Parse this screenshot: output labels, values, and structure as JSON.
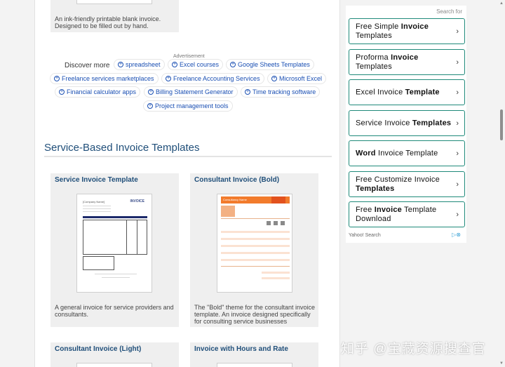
{
  "top_card": {
    "description": "An ink-friendly printable blank invoice. Designed to be filled out by hand."
  },
  "ad": {
    "label": "Advertisement",
    "discover": "Discover more",
    "chips": [
      "spreadsheet",
      "Excel courses",
      "Google Sheets Templates",
      "Freelance services marketplaces",
      "Freelance Accounting Services",
      "Microsoft Excel",
      "Financial calculator apps",
      "Billing Statement Generator",
      "Time tracking software",
      "Project management tools"
    ]
  },
  "section": {
    "title": "Service-Based Invoice Templates"
  },
  "cards": [
    {
      "title": "Service Invoice Template",
      "description": "A general invoice for service providers and consultants.",
      "thumb_company": "[Company Name]",
      "thumb_word": "INVOICE"
    },
    {
      "title": "Consultant Invoice (Bold)",
      "description": "The \"Bold\" theme for the consultant invoice template. An invoice designed specifically for consulting service businesses",
      "thumb_company": "Consultancy Name",
      "thumb_word": "INVOICE"
    },
    {
      "title": "Consultant Invoice (Light)"
    },
    {
      "title": "Invoice with Hours and Rate"
    }
  ],
  "search": {
    "header": "Search for",
    "items": [
      {
        "pre": "Free Simple ",
        "bold": "Invoice",
        "post": " Templates"
      },
      {
        "pre": "Proforma ",
        "bold": "Invoice",
        "post": " Templates"
      },
      {
        "pre": "Excel Invoice ",
        "bold": "Template",
        "post": ""
      },
      {
        "pre": "Service Invoice ",
        "bold": "Templates",
        "post": ""
      },
      {
        "pre": "",
        "bold": "Word",
        "post": " Invoice Template"
      },
      {
        "pre": "Free Customize Invoice ",
        "bold": "Templates",
        "post": ""
      },
      {
        "pre": "Free ",
        "bold": "Invoice",
        "post": " Template Download"
      }
    ],
    "footer": "Yahoo! Search",
    "icon": "ad-choices-icon"
  },
  "watermark": "知乎 @宝藏资源搜查官"
}
